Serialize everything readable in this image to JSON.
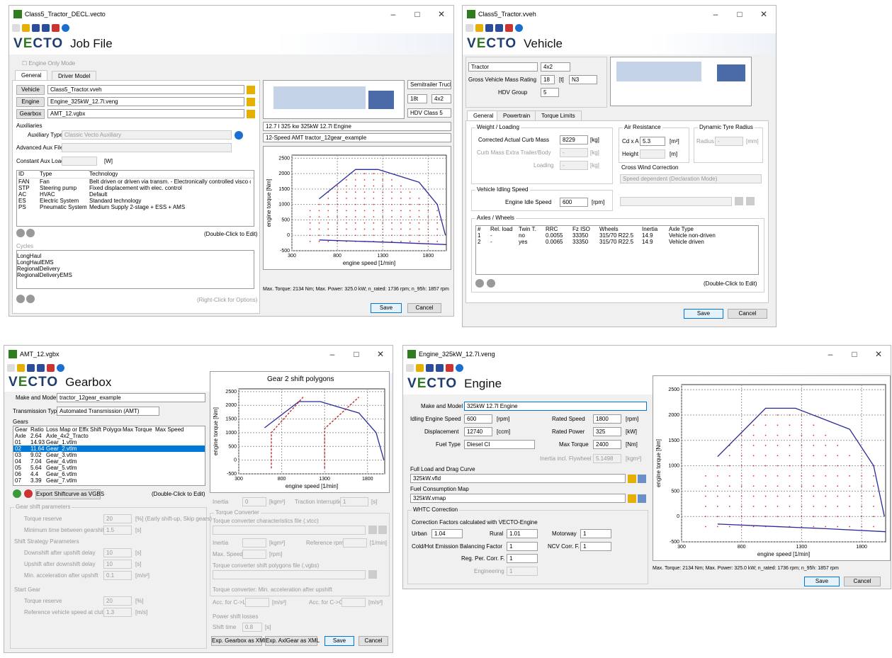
{
  "job": {
    "title": "Class5_Tractor_DECL.vecto",
    "heading": "Job File",
    "engine_only": "Engine Only Mode",
    "tabs": [
      "General",
      "Driver Model"
    ],
    "vehicle_btn": "Vehicle",
    "vehicle_file": "Class5_Tractor.vveh",
    "engine_btn": "Engine",
    "engine_file": "Engine_325kW_12.7l.veng",
    "gearbox_btn": "Gearbox",
    "gearbox_file": "AMT_12.vgbx",
    "semitrailer": "Semitrailer Truck",
    "mass": "18t",
    "axle": "4x2",
    "hdv": "HDV Class 5",
    "engine_desc": "12.7 l 325 kw 325kW 12.7l Engine",
    "gearbox_desc": "12-Speed AMT tractor_12gear_example",
    "auxiliaries": "Auxiliaries",
    "aux_type_label": "Auxiliary Type",
    "aux_type": "Classic Vecto Auxiliary",
    "adv_aux": "Advanced Aux File",
    "const_aux": "Constant Aux Load",
    "const_aux_unit": "[W]",
    "aux_cols": [
      "ID",
      "Type",
      "Technology"
    ],
    "aux_rows": [
      [
        "FAN",
        "Fan",
        "Belt driven or driven via transm. - Electronically controlled visco clutch"
      ],
      [
        "STP",
        "Steering pump",
        "Fixed displacement with elec. control"
      ],
      [
        "AC",
        "HVAC",
        "Default"
      ],
      [
        "ES",
        "Electric System",
        "Standard technology"
      ],
      [
        "PS",
        "Pneumatic System",
        "Medium Supply 2-stage + ESS + AMS"
      ]
    ],
    "dbl_click": "(Double-Click to Edit)",
    "cycles": "Cycles",
    "cycle_list": [
      "LongHaul",
      "LongHaulEMS",
      "RegionalDelivery",
      "RegionalDeliveryEMS"
    ],
    "right_click": "(Right-Click for Options)",
    "status": "Max. Torque: 2134 Nm; Max. Power: 325.0 kW; n_rated: 1736 rpm; n_95h: 1857 rpm",
    "save": "Save",
    "cancel": "Cancel"
  },
  "veh": {
    "title": "Class5_Tractor.vveh",
    "heading": "Vehicle",
    "category": "Tractor",
    "axle": "4x2",
    "gvm_label": "Gross Vehicle Mass Rating",
    "gvm": "18",
    "gvm_unit": "[t]",
    "n3": "N3",
    "hdv_label": "HDV Group",
    "hdv": "5",
    "tabs": [
      "General",
      "Powertrain",
      "Torque Limits"
    ],
    "weight": "Weight / Loading",
    "curb_label": "Corrected Actual Curb Mass",
    "curb": "8229",
    "kg": "[kg]",
    "extra": "Curb Mass Extra Trailer/Body",
    "loading": "Loading",
    "dash": "-",
    "air": "Air Resistance",
    "cdxa": "Cd x A",
    "cdxa_val": "5.3",
    "m2": "[m²]",
    "height": "Height",
    "m": "[m]",
    "tyre": "Dynamic Tyre Radius",
    "radius": "Radius",
    "mm": "[mm]",
    "cross": "Cross Wind Correction",
    "cross_val": "Speed dependent (Declaration Mode)",
    "idle_grp": "Vehicle Idling Speed",
    "idle_label": "Engine Idle Speed",
    "idle": "600",
    "rpm": "[rpm]",
    "axles": "Axles / Wheels",
    "axle_cols": [
      "#",
      "Rel. load",
      "Twin T.",
      "RRC",
      "Fz ISO",
      "Wheels",
      "Inertia",
      "Axle Type"
    ],
    "axle_rows": [
      [
        "1",
        "-",
        "no",
        "0.0055",
        "33350",
        "315/70 R22.5",
        "14.9",
        "Vehicle non-driven"
      ],
      [
        "2",
        "-",
        "yes",
        "0.0065",
        "33350",
        "315/70 R22.5",
        "14.9",
        "Vehicle driven"
      ]
    ],
    "dbl_click": "(Double-Click to Edit)",
    "save": "Save",
    "cancel": "Cancel"
  },
  "gbx": {
    "title": "AMT_12.vgbx",
    "heading": "Gearbox",
    "make_label": "Make and Model",
    "make": "tractor_12gear_example",
    "tt_label": "Transmission Type",
    "tt": "Automated Transmission (AMT)",
    "gears": "Gears",
    "gear_cols": [
      "Gear",
      "Ratio",
      "Loss Map or Efficie...",
      "Shift Polygons",
      "Max Torque",
      "Max Speed"
    ],
    "gear_rows": [
      [
        "Axle",
        "2.64",
        "Axle_4x2_Tractor..."
      ],
      [
        "01",
        "14.93",
        "Gear_1.vtlm"
      ],
      [
        "02",
        "11.64",
        "Gear_2.vtlm"
      ],
      [
        "03",
        "9.02",
        "Gear_3.vtlm"
      ],
      [
        "04",
        "7.04",
        "Gear_4.vtlm"
      ],
      [
        "05",
        "5.64",
        "Gear_5.vtlm"
      ],
      [
        "06",
        "4.4",
        "Gear_6.vtlm"
      ],
      [
        "07",
        "3.39",
        "Gear_7.vtlm"
      ]
    ],
    "export_vgbs": "Export Shiftcurve as VGBS",
    "dbl_click": "(Double-Click to Edit)",
    "shift_params": "Gear shift parameters",
    "torque_reserve": "Torque reserve",
    "tr_val": "20",
    "tr_unit": "[%] (Early shift-up, Skip gears)",
    "min_time": "Minimum time between gearshifts",
    "mt_val": "1.5",
    "s": "[s]",
    "strategy": "Shift Strategy Parameters",
    "down_delay": "Downshift after upshift delay",
    "dd_val": "10",
    "up_delay": "Upshift after downshift delay",
    "ud_val": "10",
    "min_acc": "Min. acceleration after upshift",
    "ma_val": "0.1",
    "ms2": "[m/s²]",
    "start_gear": "Start Gear",
    "sg_tr": "Torque reserve",
    "sg_tr_val": "20",
    "pct": "[%]",
    "ref_speed": "Reference vehicle speed at clutch-in",
    "rs_val": "1.3",
    "ms": "[m/s]",
    "chart_title": "Gear 2 shift polygons",
    "inertia": "Inertia",
    "inertia_val": "0",
    "kgm2": "[kgm²]",
    "traction": "Traction Interruption",
    "traction_val": "1",
    "tc": "Torque Converter",
    "tc_file": "Torque converter characteristics file (.vtcc)",
    "tc_inertia": "Inertia",
    "ref_rpm": "Reference rpm",
    "per_min": "[1/min]",
    "max_speed": "Max. Speed",
    "rpm": "[rpm]",
    "tc_shift": "Torque converter shift polygons file (.vgbs)",
    "tc_min_acc": "Torque converter: Min. acceleration after upshift",
    "acc_cl": "Acc. for C->L",
    "acc_cc": "Acc. for C->C",
    "psl": "Power shift losses",
    "shift_time": "Shift time",
    "st_val": "0.8",
    "exp_gbx": "Exp. Gearbox as XML",
    "exp_axl": "Exp. AxlGear as XML",
    "save": "Save",
    "cancel": "Cancel"
  },
  "eng": {
    "title": "Engine_325kW_12.7l.veng",
    "heading": "Engine",
    "make_label": "Make and Model",
    "make": "325kW 12.7l Engine",
    "idle_label": "Idling Engine Speed",
    "idle": "600",
    "rpm": "[rpm]",
    "disp_label": "Displacement",
    "disp": "12740",
    "ccm": "[ccm]",
    "fuel_label": "Fuel Type",
    "fuel": "Diesel CI",
    "rs_label": "Rated Speed",
    "rs": "1800",
    "rp_label": "Rated Power",
    "rp": "325",
    "kw": "[kW]",
    "mt_label": "Max Torque",
    "mt": "2400",
    "nm": "[Nm]",
    "flywheel": "Inertia incl. Flywheel",
    "fw_val": "5.1498",
    "kgm2": "[kgm²]",
    "fld_label": "Full Load and Drag Curve",
    "fld": "325kW.vfld",
    "fcm_label": "Fuel Consumption Map",
    "fcm": "325kW.vmap",
    "whtc": "WHTC Correction",
    "cf": "Correction Factors calculated with VECTO-Engine",
    "urban": "Urban",
    "urban_v": "1.04",
    "rural": "Rural",
    "rural_v": "1.01",
    "motorway": "Motorway",
    "motorway_v": "1",
    "cold": "Cold/Hot Emission Balancing Factor",
    "cold_v": "1",
    "ncv": "NCV Corr. F.",
    "ncv_v": "1",
    "reg": "Reg. Per. Corr. F.",
    "reg_v": "1",
    "engineering": "Engineering",
    "eng_v": "1",
    "status": "Max. Torque: 2134 Nm; Max. Power: 325.0 kW; n_rated: 1736 rpm; n_95h: 1857 rpm",
    "save": "Save",
    "cancel": "Cancel"
  },
  "charts": {
    "xlabel": "engine speed [1/min]",
    "ylabel": "engine torque [Nm]",
    "xticks": [
      "300",
      "800",
      "1300",
      "1800"
    ],
    "yticks": [
      "2500",
      "2000",
      "1500",
      "1000",
      "500",
      "0",
      "-500"
    ]
  },
  "chart_data": [
    {
      "type": "line",
      "title": "",
      "xlabel": "engine speed [1/min]",
      "ylabel": "engine torque [Nm]",
      "xlim": [
        300,
        2000
      ],
      "ylim": [
        -500,
        2600
      ],
      "grid": true,
      "series": [
        {
          "values": [
            [
              600,
              1180
            ],
            [
              1000,
              2134
            ],
            [
              1250,
              2134
            ],
            [
              1450,
              1950
            ],
            [
              1700,
              1720
            ],
            [
              1900,
              1000
            ],
            [
              1990,
              0
            ]
          ]
        },
        {
          "values": [
            [
              600,
              -150
            ],
            [
              1000,
              -190
            ],
            [
              1500,
              -240
            ],
            [
              2000,
              -300
            ]
          ]
        }
      ]
    },
    {
      "type": "line",
      "title": "Gear 2 shift polygons",
      "xlabel": "engine speed [1/min]",
      "ylabel": "engine torque [Nm]",
      "xlim": [
        300,
        2000
      ],
      "ylim": [
        -500,
        2600
      ],
      "grid": true,
      "series": [
        {
          "values": [
            [
              600,
              1180
            ],
            [
              1000,
              2134
            ],
            [
              1250,
              2134
            ],
            [
              1450,
              1950
            ],
            [
              1700,
              1720
            ],
            [
              1900,
              1000
            ],
            [
              1990,
              0
            ]
          ]
        },
        {
          "values": [
            [
              680,
              -300
            ],
            [
              680,
              1000
            ],
            [
              1050,
              2300
            ]
          ]
        },
        {
          "values": [
            [
              1300,
              -300
            ],
            [
              1300,
              1150
            ],
            [
              1700,
              2300
            ]
          ]
        }
      ]
    }
  ]
}
